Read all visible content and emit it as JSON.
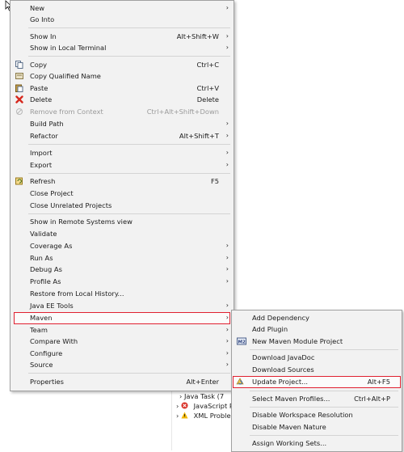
{
  "main_menu": {
    "items": [
      {
        "label": "New",
        "shortcut": "",
        "submenu": true
      },
      {
        "label": "Go Into",
        "shortcut": "",
        "submenu": false
      },
      {
        "label": "Show In",
        "shortcut": "Alt+Shift+W",
        "submenu": true
      },
      {
        "label": "Show in Local Terminal",
        "shortcut": "",
        "submenu": true
      },
      {
        "label": "Copy",
        "shortcut": "Ctrl+C",
        "submenu": false
      },
      {
        "label": "Copy Qualified Name",
        "shortcut": "",
        "submenu": false
      },
      {
        "label": "Paste",
        "shortcut": "Ctrl+V",
        "submenu": false
      },
      {
        "label": "Delete",
        "shortcut": "Delete",
        "submenu": false
      },
      {
        "label": "Remove from Context",
        "shortcut": "Ctrl+Alt+Shift+Down",
        "submenu": false
      },
      {
        "label": "Build Path",
        "shortcut": "",
        "submenu": true
      },
      {
        "label": "Refactor",
        "shortcut": "Alt+Shift+T",
        "submenu": true
      },
      {
        "label": "Import",
        "shortcut": "",
        "submenu": true
      },
      {
        "label": "Export",
        "shortcut": "",
        "submenu": true
      },
      {
        "label": "Refresh",
        "shortcut": "F5",
        "submenu": false
      },
      {
        "label": "Close Project",
        "shortcut": "",
        "submenu": false
      },
      {
        "label": "Close Unrelated Projects",
        "shortcut": "",
        "submenu": false
      },
      {
        "label": "Show in Remote Systems view",
        "shortcut": "",
        "submenu": false
      },
      {
        "label": "Validate",
        "shortcut": "",
        "submenu": false
      },
      {
        "label": "Coverage As",
        "shortcut": "",
        "submenu": true
      },
      {
        "label": "Run As",
        "shortcut": "",
        "submenu": true
      },
      {
        "label": "Debug As",
        "shortcut": "",
        "submenu": true
      },
      {
        "label": "Profile As",
        "shortcut": "",
        "submenu": true
      },
      {
        "label": "Restore from Local History...",
        "shortcut": "",
        "submenu": false
      },
      {
        "label": "Java EE Tools",
        "shortcut": "",
        "submenu": true
      },
      {
        "label": "Maven",
        "shortcut": "",
        "submenu": true
      },
      {
        "label": "Team",
        "shortcut": "",
        "submenu": true
      },
      {
        "label": "Compare With",
        "shortcut": "",
        "submenu": true
      },
      {
        "label": "Configure",
        "shortcut": "",
        "submenu": true
      },
      {
        "label": "Source",
        "shortcut": "",
        "submenu": true
      },
      {
        "label": "Properties",
        "shortcut": "Alt+Enter",
        "submenu": false
      }
    ]
  },
  "maven_menu": {
    "items": [
      {
        "label": "Add Dependency",
        "shortcut": ""
      },
      {
        "label": "Add Plugin",
        "shortcut": ""
      },
      {
        "label": "New Maven Module Project",
        "shortcut": ""
      },
      {
        "label": "Download JavaDoc",
        "shortcut": ""
      },
      {
        "label": "Download Sources",
        "shortcut": ""
      },
      {
        "label": "Update Project...",
        "shortcut": "Alt+F5"
      },
      {
        "label": "Select Maven Profiles...",
        "shortcut": "Ctrl+Alt+P"
      },
      {
        "label": "Disable Workspace Resolution",
        "shortcut": ""
      },
      {
        "label": "Disable Maven Nature",
        "shortcut": ""
      },
      {
        "label": "Assign Working Sets...",
        "shortcut": ""
      }
    ]
  },
  "background_tree": {
    "items": [
      "Java Task (7",
      "JavaScript P",
      "XML Problem"
    ]
  },
  "colors": {
    "highlight_border": "#e02030",
    "menu_bg": "#f2f2f2"
  }
}
